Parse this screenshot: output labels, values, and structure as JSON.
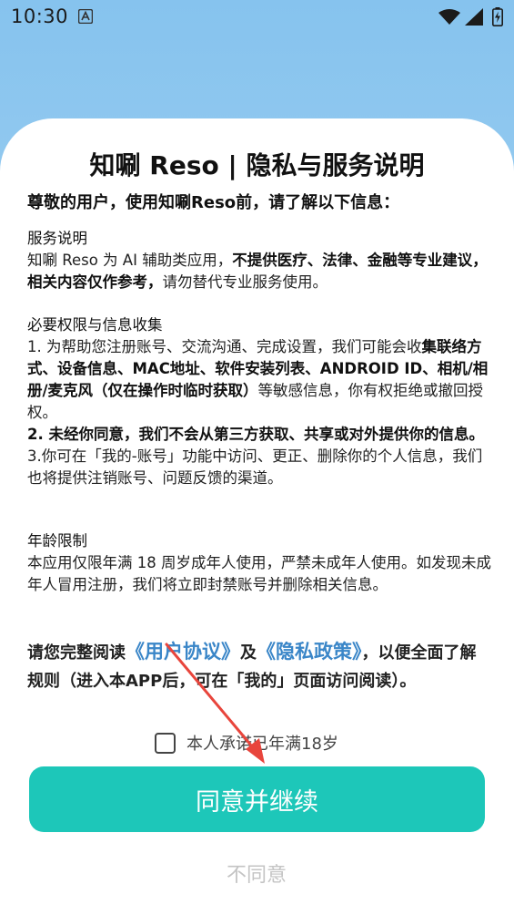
{
  "status_bar": {
    "time": "10:30",
    "icons": [
      "a-notification-icon",
      "wifi-icon",
      "signal-icon",
      "battery-icon"
    ]
  },
  "dialog": {
    "title": "知唰 Reso | 隐私与服务说明",
    "greeting": "尊敬的用户，使用知唰Reso前，请了解以下信息：",
    "service": {
      "title": "服务说明",
      "text_1": "知唰 Reso 为 AI 辅助类应用，",
      "text_2": "不提供医疗、法律、金融等专业建议，相关内容仅作参考，",
      "text_3": "请勿替代专业服务使用。"
    },
    "permissions": {
      "title": "必要权限与信息收集",
      "item1_a": "1. 为帮助您注册账号、交流沟通、完成设置，我们可能会收",
      "item1_b": "集联络方式、设备信息、MAC地址、软件安装列表、ANDROID ID、相机/相册/麦克风（仅在操作时临时获取）",
      "item1_c": "等敏感信息，你有权拒绝或撤回授权。",
      "item2": "2. 未经你同意，我们不会从第三方获取、共享或对外提供你的信息。",
      "item3_a": "3.你可在「我的-账号」功能中访问、更正、删除你的个人信",
      "item3_b": "息，我们也将提供注销账号、问题反馈的渠道。"
    },
    "age": {
      "title": "年龄限制",
      "text_a": "本应用仅限年满 18 周岁成年人使用，严禁未成年人使用。",
      "text_b": "如发现未成年人冒用注册，我们将立即封禁账号并删除相关信息。"
    },
    "notice": {
      "prefix": "请您完整阅读",
      "user_agreement": "《用户协议》",
      "and": "及",
      "privacy_policy": "《隐私政策》",
      "suffix": "，以便全面了解规则（进入本APP后，可在「我的」页面访问阅读）。"
    },
    "age_checkbox_label": "本人承诺已年满18岁",
    "agree_label": "同意并继续",
    "disagree_label": "不同意"
  },
  "colors": {
    "accent": "#1dc7b9",
    "link": "#3a86c8",
    "annotation_arrow": "#e8453c",
    "background_top": "#86c3ee"
  }
}
